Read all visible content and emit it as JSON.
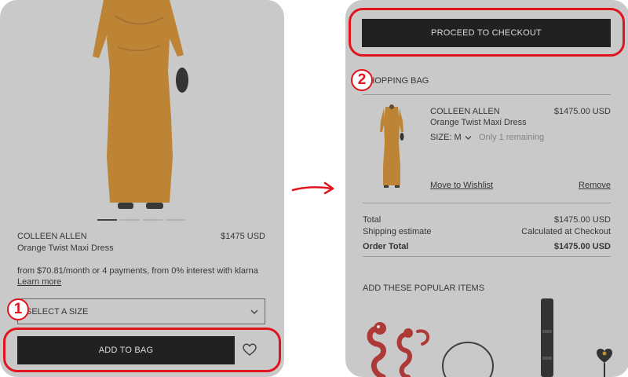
{
  "left": {
    "product": {
      "brand": "COLLEEN ALLEN",
      "name": "Orange Twist Maxi Dress",
      "price": "$1475 USD"
    },
    "installments_text": "from $70.81/month or 4 payments, from 0% interest with klarna",
    "learn_more": "Learn more",
    "size_select_placeholder": "SELECT A SIZE",
    "add_to_bag": "ADD TO BAG",
    "step_number": "1",
    "carousel_active_index": 0,
    "carousel_count": 4
  },
  "right": {
    "checkout_button": "PROCEED TO CHECKOUT",
    "section_title": "SHOPPING BAG",
    "step_number": "2",
    "item": {
      "brand": "COLLEEN ALLEN",
      "name": "Orange Twist Maxi Dress",
      "price": "$1475.00 USD",
      "size_label": "SIZE: M",
      "stock_note": "Only 1 remaining",
      "move_to_wishlist": "Move to Wishlist",
      "remove": "Remove"
    },
    "summary": {
      "total_label": "Total",
      "total_value": "$1475.00 USD",
      "shipping_label": "Shipping estimate",
      "shipping_value": "Calculated at Checkout",
      "order_total_label": "Order Total",
      "order_total_value": "$1475.00 USD"
    },
    "popular_title": "ADD THESE POPULAR ITEMS"
  },
  "colors": {
    "annotation_red": "#e0141c",
    "dress_orange": "#d98a1d",
    "button_black": "#000000"
  }
}
